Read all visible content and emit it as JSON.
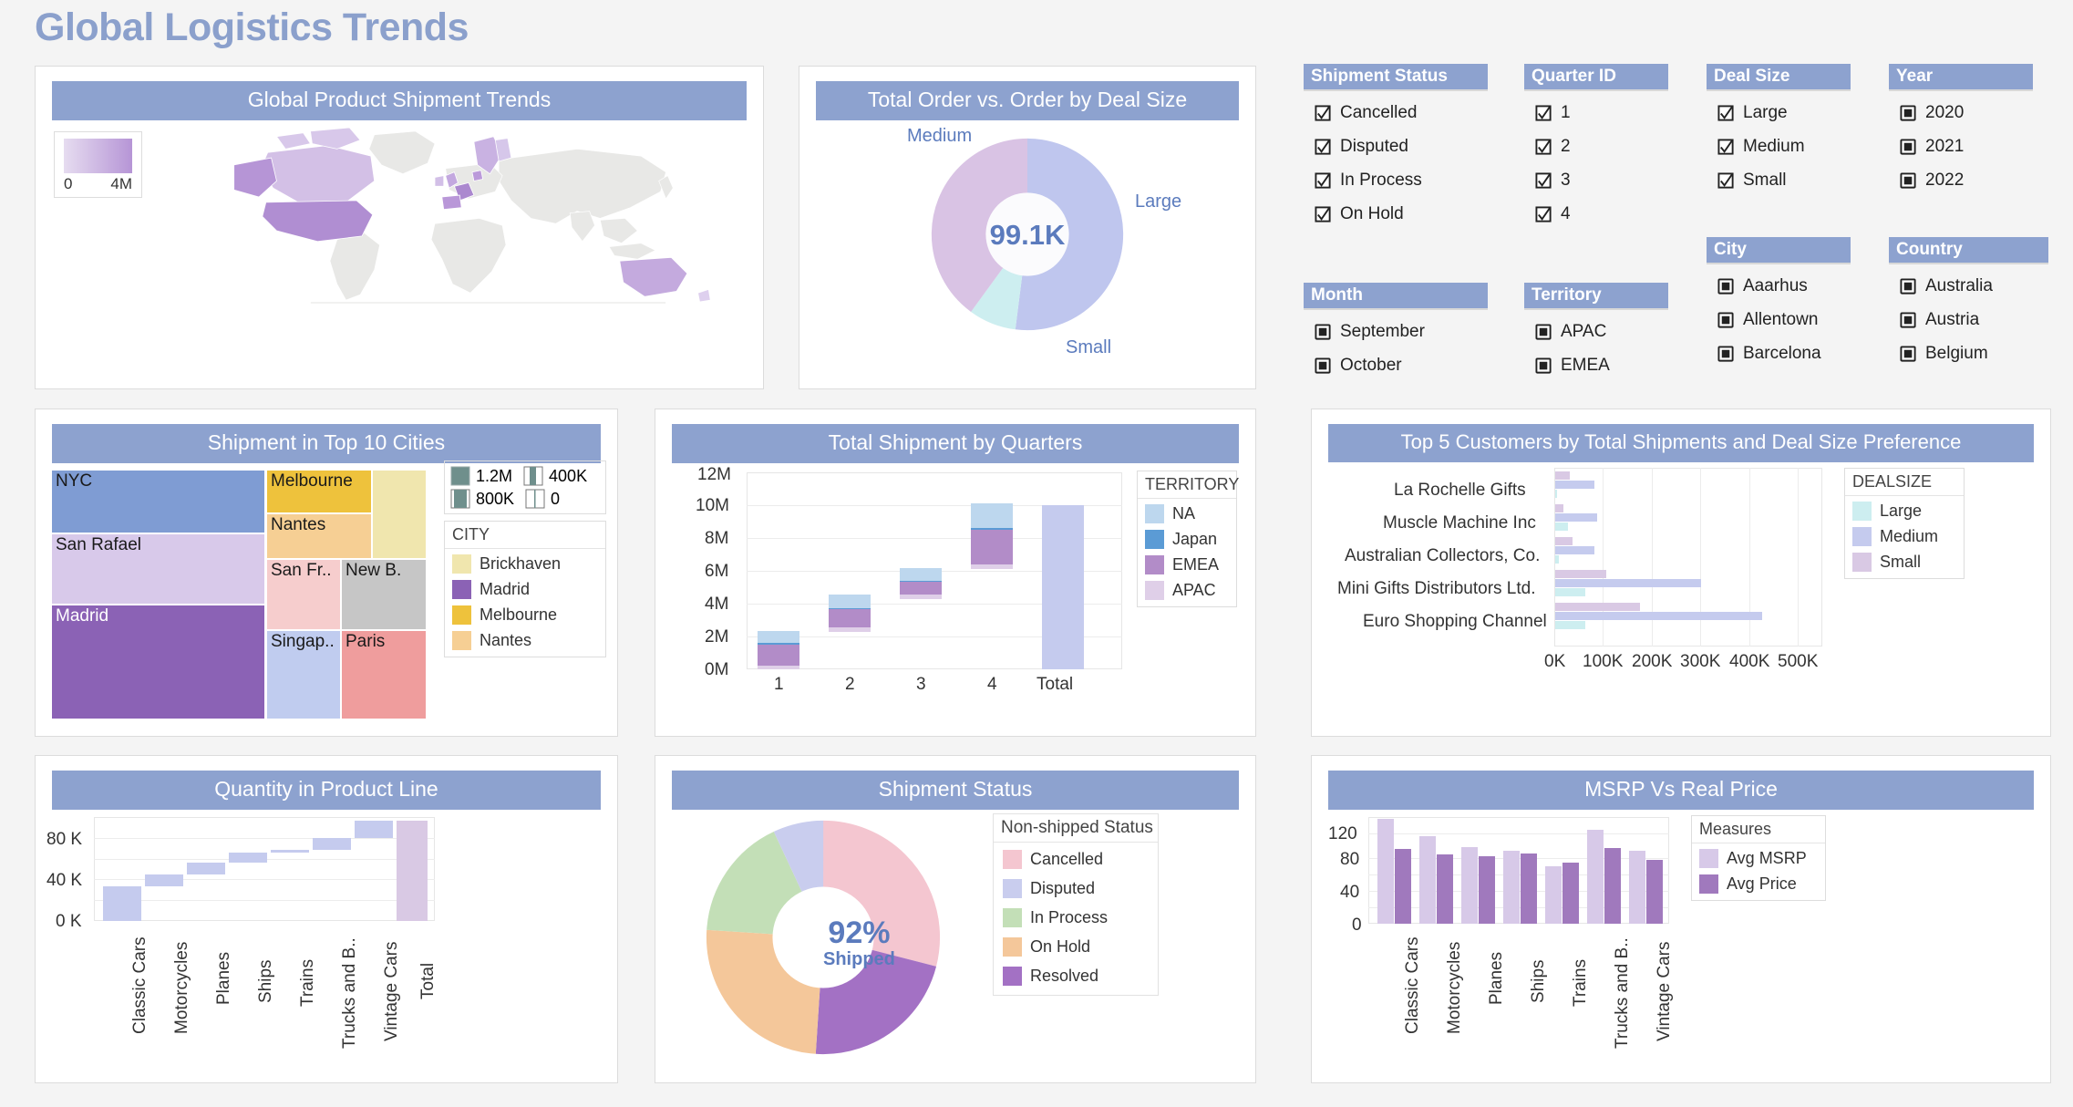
{
  "page": {
    "title": "Global Logistics Trends",
    "accent": "#8da2cf",
    "background": "#f4f4f4"
  },
  "map_card": {
    "title": "Global Product Shipment Trends",
    "legend": {
      "min": "0",
      "max": "4M",
      "gradient_from": "#e6dcf0",
      "gradient_to": "#b695d6"
    }
  },
  "donut_deal": {
    "title": "Total Order vs. Order by Deal Size",
    "center_value": "99.1K",
    "labels": {
      "medium": "Medium",
      "large": "Large",
      "small": "Small"
    }
  },
  "filters": {
    "groups": [
      {
        "name": "Shipment Status",
        "type": "checkbox",
        "items": [
          "Cancelled",
          "Disputed",
          "In Process",
          "On Hold"
        ]
      },
      {
        "name": "Quarter ID",
        "type": "checkbox",
        "items": [
          "1",
          "2",
          "3",
          "4"
        ]
      },
      {
        "name": "Deal Size",
        "type": "checkbox",
        "items": [
          "Large",
          "Medium",
          "Small"
        ]
      },
      {
        "name": "Year",
        "type": "radio",
        "items": [
          "2020",
          "2021",
          "2022"
        ]
      },
      {
        "name": "Month",
        "type": "radio",
        "items": [
          "September",
          "October"
        ]
      },
      {
        "name": "Territory",
        "type": "radio",
        "items": [
          "APAC",
          "EMEA"
        ]
      },
      {
        "name": "City",
        "type": "radio",
        "items": [
          "Aaarhus",
          "Allentown",
          "Barcelona"
        ]
      },
      {
        "name": "Country",
        "type": "radio",
        "items": [
          "Australia",
          "Austria",
          "Belgium"
        ]
      }
    ]
  },
  "treemap_card": {
    "title": "Shipment in Top 10 Cities",
    "size_legend": [
      {
        "label": "1.2M",
        "fill": 1.0
      },
      {
        "label": "800K",
        "fill": 0.6
      },
      {
        "label": "400K",
        "fill": 0.35
      },
      {
        "label": "0",
        "fill": 0.08
      }
    ],
    "legend_title": "CITY",
    "legend_items": [
      {
        "label": "Brickhaven",
        "color": "#f0e6ae"
      },
      {
        "label": "Madrid",
        "color": "#8b62b5"
      },
      {
        "label": "Melbourne",
        "color": "#eec23c"
      },
      {
        "label": "Nantes",
        "color": "#f6cf94"
      }
    ]
  },
  "quarters_card": {
    "title": "Total Shipment by Quarters",
    "legend_title": "TERRITORY",
    "legend_items": [
      {
        "label": "NA",
        "color": "#bdd7ee"
      },
      {
        "label": "Japan",
        "color": "#5b9bd5"
      },
      {
        "label": "EMEA",
        "color": "#b28cc8"
      },
      {
        "label": "APAC",
        "color": "#dfcfe8"
      }
    ]
  },
  "customers_card": {
    "title": "Top 5 Customers by Total Shipments and Deal Size Preference",
    "legend_title": "DEALSIZE",
    "legend_items": [
      {
        "label": "Large",
        "color": "#cdeef0"
      },
      {
        "label": "Medium",
        "color": "#c5cbee"
      },
      {
        "label": "Small",
        "color": "#d9c9e4"
      }
    ]
  },
  "product_line_card": {
    "title": "Quantity in Product Line"
  },
  "status_card": {
    "title": "Shipment Status",
    "center_value": "92%",
    "center_sub": "Shipped",
    "legend_title": "Non-shipped Status",
    "legend_items": [
      {
        "label": "Cancelled",
        "color": "#f4c6d0"
      },
      {
        "label": "Disputed",
        "color": "#c9cdee"
      },
      {
        "label": "In Process",
        "color": "#c3dfb7"
      },
      {
        "label": "On Hold",
        "color": "#f4c79a"
      },
      {
        "label": "Resolved",
        "color": "#a371c4"
      }
    ]
  },
  "msrp_card": {
    "title": "MSRP Vs Real Price",
    "legend_title": "Measures",
    "legend_items": [
      {
        "label": "Avg MSRP",
        "color": "#d7c9e8"
      },
      {
        "label": "Avg Price",
        "color": "#a craft"
      }
    ]
  },
  "chart_data": [
    {
      "id": "global-shipment-map",
      "type": "map",
      "title": "Global Product Shipment Trends",
      "legend_range": [
        0,
        4000000
      ],
      "legend_tick_labels": [
        "0",
        "4M"
      ],
      "regions": [
        {
          "name": "USA",
          "value": 3600000
        },
        {
          "name": "Canada",
          "value": 900000
        },
        {
          "name": "Alaska",
          "value": 2600000
        },
        {
          "name": "Australia",
          "value": 1500000
        },
        {
          "name": "France",
          "value": 2000000
        },
        {
          "name": "Spain",
          "value": 1700000
        },
        {
          "name": "UK",
          "value": 1300000
        },
        {
          "name": "Norway",
          "value": 1100000
        },
        {
          "name": "Sweden",
          "value": 900000
        },
        {
          "name": "Finland",
          "value": 800000
        }
      ]
    },
    {
      "id": "total-order-by-deal-size",
      "type": "pie",
      "title": "Total Order vs. Order by Deal Size",
      "center_label": "99.1K",
      "labels": [
        "Medium",
        "Small",
        "Large"
      ],
      "values": [
        52,
        40,
        8
      ],
      "colors": [
        "#bfc6ee",
        "#d9c3e4",
        "#cdeef0"
      ],
      "legend": "outside-labels"
    },
    {
      "id": "shipment-top-10-cities",
      "type": "treemap",
      "title": "Shipment in Top 10 Cities",
      "size_legend": [
        "1.2M",
        "800K",
        "400K",
        "0"
      ],
      "legend_title": "CITY",
      "items": [
        {
          "label": "NYC",
          "value": 1050000,
          "color": "#7f9cd3"
        },
        {
          "label": "San Rafael",
          "value": 950000,
          "color": "#d8c9ea"
        },
        {
          "label": "Madrid",
          "value": 1800000,
          "color": "#8b62b5"
        },
        {
          "label": "Melbourne",
          "value": 430000,
          "color": "#eec23c"
        },
        {
          "label": "Nantes",
          "value": 420000,
          "color": "#f6cf94"
        },
        {
          "label": "Brickhaven",
          "value": 500000,
          "color": "#f0e6ae"
        },
        {
          "label": "San Fr..",
          "value": 340000,
          "color": "#f6cdcd"
        },
        {
          "label": "New B.",
          "value": 340000,
          "color": "#c6c6c6"
        },
        {
          "label": "Singap..",
          "value": 330000,
          "color": "#c0ccef"
        },
        {
          "label": "Paris",
          "value": 360000,
          "color": "#ef9d9d"
        }
      ]
    },
    {
      "id": "total-shipment-by-quarters",
      "type": "bar",
      "subtype": "stacked-waterfall",
      "title": "Total Shipment by Quarters",
      "categories": [
        "1",
        "2",
        "3",
        "4",
        "Total"
      ],
      "xlabel": "",
      "ylabel": "",
      "ylim": [
        0,
        12000000
      ],
      "ytick_labels": [
        "0M",
        "2M",
        "4M",
        "6M",
        "8M",
        "10M",
        "12M"
      ],
      "legend_title": "TERRITORY",
      "series": [
        {
          "name": "APAC",
          "color": "#dfcfe8",
          "values": [
            130000,
            160000,
            180000,
            260000,
            0
          ]
        },
        {
          "name": "EMEA",
          "color": "#b28cc8",
          "values": [
            1250000,
            1100000,
            750000,
            2100000,
            0
          ]
        },
        {
          "name": "Japan",
          "color": "#5b9bd5",
          "values": [
            90000,
            70000,
            70000,
            100000,
            0
          ]
        },
        {
          "name": "NA",
          "color": "#bdd7ee",
          "values": [
            880000,
            830000,
            780000,
            1520000,
            0
          ]
        }
      ],
      "cumulative_base": [
        0,
        2350000,
        4410000,
        6160000,
        0
      ],
      "total_value": 10000000,
      "total_color": "#c5cbee"
    },
    {
      "id": "top-5-customers",
      "type": "bar",
      "subtype": "horizontal-grouped",
      "title": "Top 5 Customers by Total Shipments and Deal Size Preference",
      "categories": [
        "La Rochelle Gifts",
        "Muscle Machine Inc",
        "Australian Collectors, Co.",
        "Mini Gifts Distributors Ltd.",
        "Euro Shopping Channel"
      ],
      "xtick_labels": [
        "0K",
        "100K",
        "200K",
        "300K",
        "400K",
        "500K"
      ],
      "xlim": [
        0,
        550000
      ],
      "legend_title": "DEALSIZE",
      "series": [
        {
          "name": "Small",
          "color": "#d9c9e4",
          "values": [
            30000,
            17000,
            35000,
            105000,
            175000
          ]
        },
        {
          "name": "Medium",
          "color": "#c5cbee",
          "values": [
            80000,
            85000,
            80000,
            300000,
            425000
          ]
        },
        {
          "name": "Large",
          "color": "#cdeef0",
          "values": [
            3000,
            25000,
            7000,
            62000,
            62000
          ]
        }
      ]
    },
    {
      "id": "quantity-in-product-line",
      "type": "bar",
      "subtype": "waterfall",
      "title": "Quantity in Product Line",
      "categories": [
        "Classic Cars",
        "Motorcycles",
        "Planes",
        "Ships",
        "Trains",
        "Trucks and B..",
        "Vintage Cars",
        "Total"
      ],
      "ylim": [
        0,
        100000
      ],
      "ytick_labels": [
        "0 K",
        "40 K",
        "80 K"
      ],
      "values": [
        33000,
        11500,
        11500,
        9500,
        2500,
        11500,
        16000
      ],
      "total": 95500,
      "bar_color": "#c5cbee",
      "total_color": "#d9c9e4"
    },
    {
      "id": "shipment-status",
      "type": "pie",
      "title": "Shipment Status",
      "center_label": "92%",
      "center_sublabel": "Shipped",
      "legend_title": "Non-shipped Status",
      "labels": [
        "Cancelled",
        "Resolved",
        "On Hold",
        "In Process",
        "Disputed"
      ],
      "values": [
        29,
        22,
        25,
        17,
        7
      ],
      "colors": [
        "#f4c6d0",
        "#a371c4",
        "#f4c79a",
        "#c3dfb7",
        "#c9cdee"
      ]
    },
    {
      "id": "msrp-vs-real-price",
      "type": "bar",
      "subtype": "grouped",
      "title": "MSRP Vs Real Price",
      "categories": [
        "Classic Cars",
        "Motorcycles",
        "Planes",
        "Ships",
        "Trains",
        "Trucks and B..",
        "Vintage Cars"
      ],
      "ylim": [
        0,
        130
      ],
      "ytick_labels": [
        "0",
        "40",
        "80",
        "120"
      ],
      "legend_title": "Measures",
      "series": [
        {
          "name": "Avg MSRP",
          "color": "#d7c9e8",
          "values": [
            128,
            107,
            93,
            89,
            70,
            115,
            89
          ]
        },
        {
          "name": "Avg Price",
          "color": "#a079bd",
          "values": [
            91,
            84,
            82,
            85,
            74,
            92,
            78
          ]
        }
      ]
    }
  ]
}
